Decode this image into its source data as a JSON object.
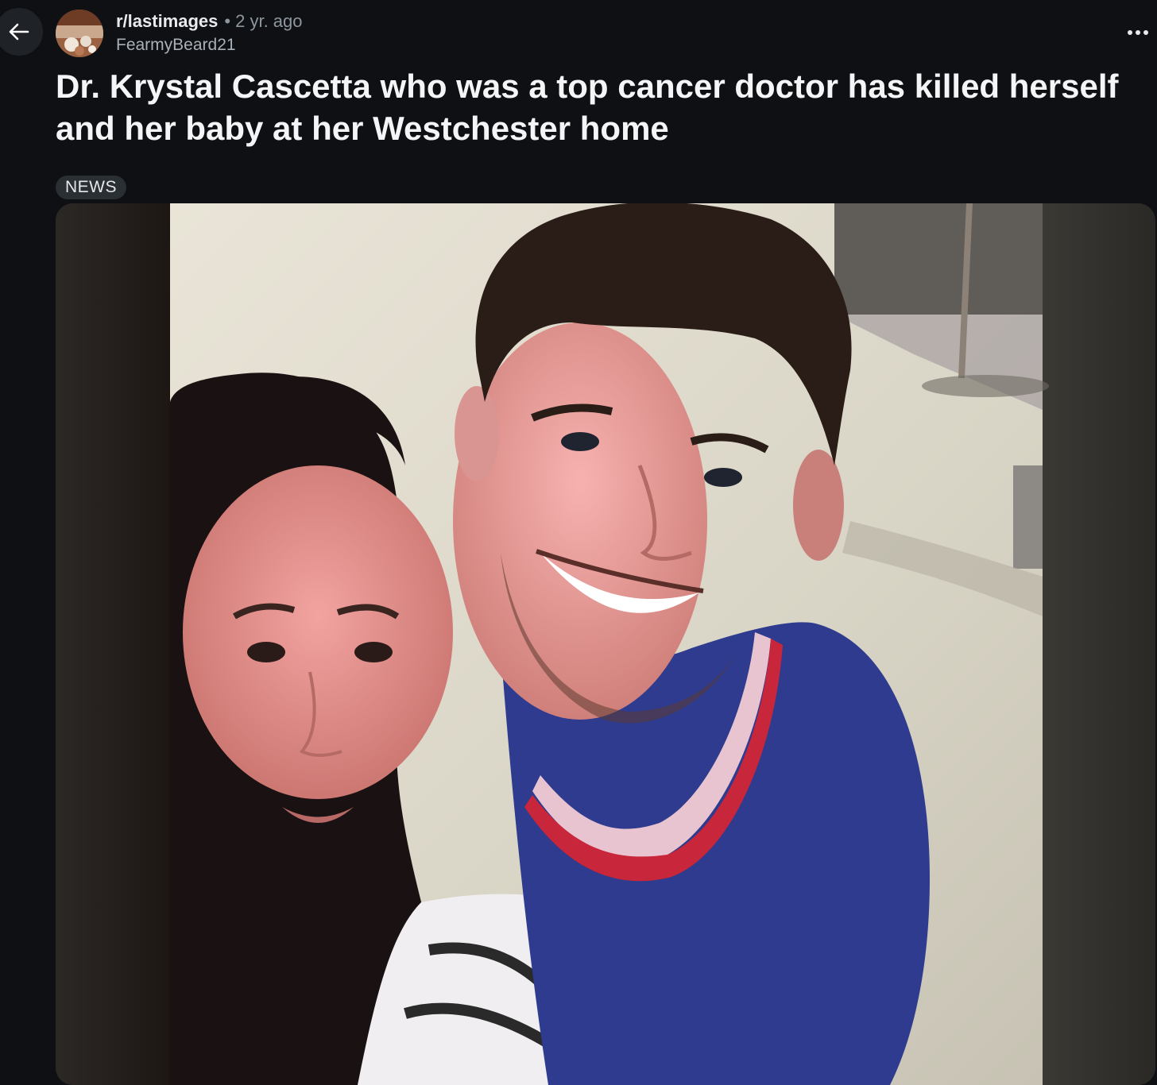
{
  "post": {
    "subreddit": "r/lastimages",
    "separator": "•",
    "age": "2 yr. ago",
    "author": "FearmyBeard21",
    "title": "Dr. Krystal Cascetta who was a top cancer doctor has killed herself and her baby at her Westchester home",
    "flair": "NEWS"
  },
  "icons": {
    "back": "arrow-left-icon",
    "more": "more-horizontal-icon",
    "avatar": "subreddit-avatar"
  },
  "colors": {
    "background": "#0e1013",
    "flair_bg": "#2a2f34",
    "muted_text": "#8d969e"
  }
}
